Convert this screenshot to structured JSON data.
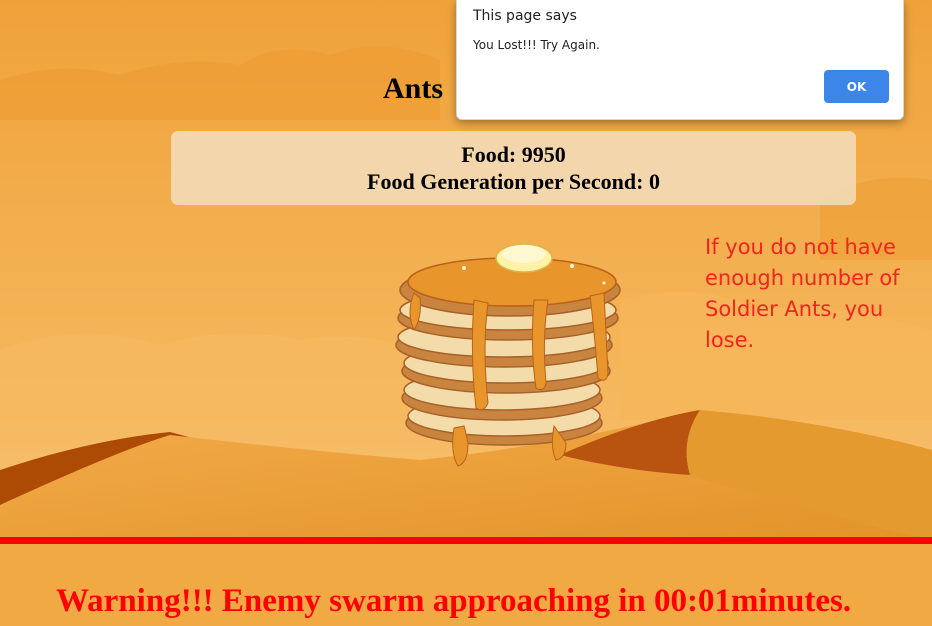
{
  "game": {
    "title": "Ants",
    "food_text": "Food: 9950",
    "food_generation_text": "Food Generation per Second: 0",
    "hint": "If you do not have enough number of Soldier Ants, you lose.",
    "warning": "Warning!!! Enemy swarm approaching in 00:01minutes.",
    "food_item_icon": "pancake-stack"
  },
  "alert": {
    "title": "This page says",
    "message": "You Lost!!! Try Again.",
    "ok_label": "OK"
  },
  "colors": {
    "sky": "#f1a943",
    "dune_light": "#eb9a32",
    "dune_dark": "#ad4a04",
    "warning_red": "#ff0000",
    "hint_red": "#f0251f",
    "ok_blue": "#3b86e8"
  }
}
